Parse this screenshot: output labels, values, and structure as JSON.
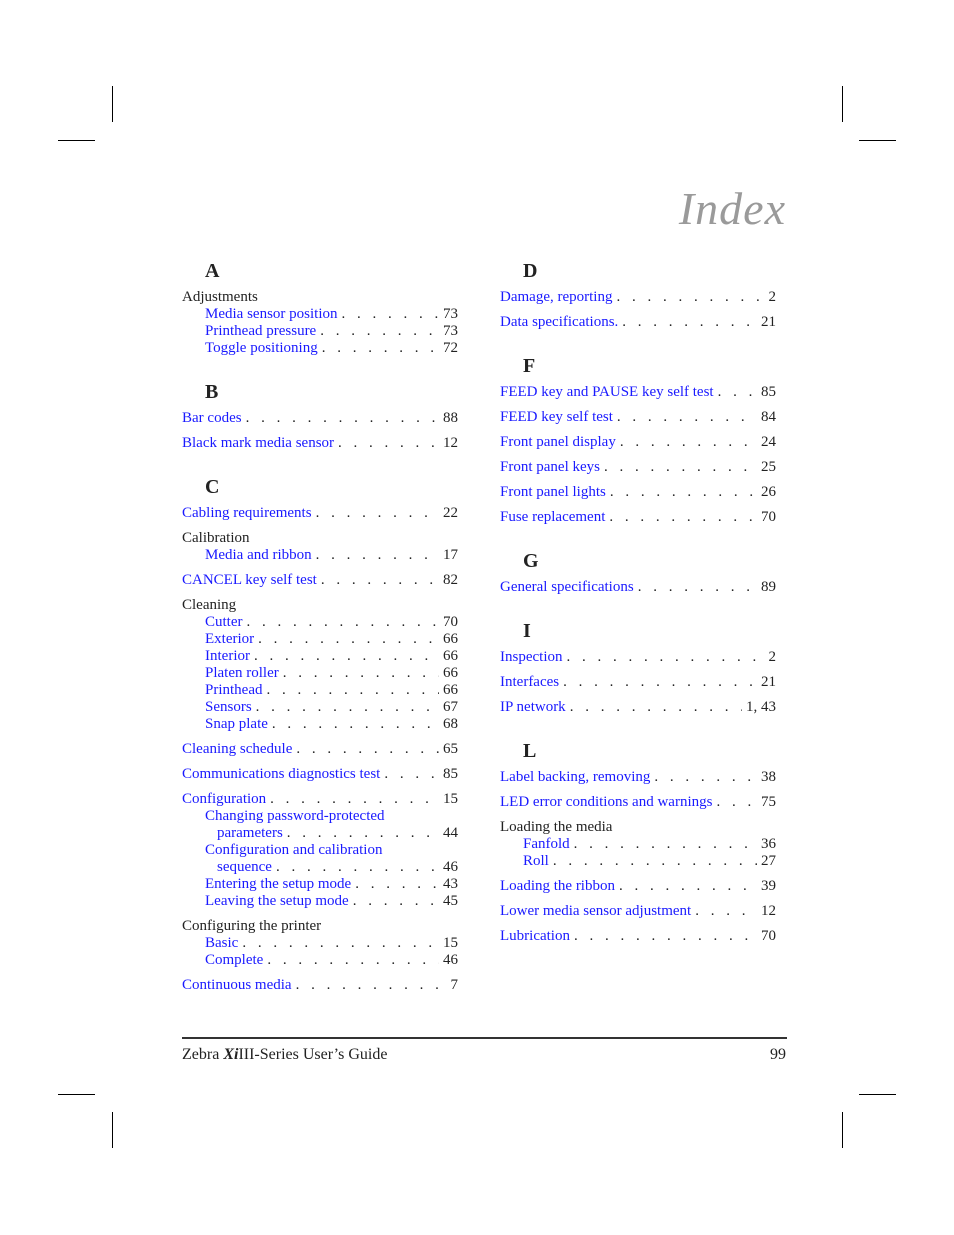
{
  "title": "Index",
  "left_column": [
    {
      "letter": "A",
      "entries": [
        {
          "label": "Adjustments",
          "page": "",
          "level": 0,
          "head": true
        },
        {
          "label": "Media sensor position",
          "page": "73",
          "level": 1
        },
        {
          "label": "Printhead pressure",
          "page": "73",
          "level": 1
        },
        {
          "label": "Toggle positioning",
          "page": "72",
          "level": 1
        }
      ]
    },
    {
      "letter": "B",
      "entries": [
        {
          "label": "Bar codes",
          "page": "88",
          "level": 0
        },
        {
          "label": "Black mark media sensor",
          "page": "12",
          "level": 0
        }
      ]
    },
    {
      "letter": "C",
      "entries": [
        {
          "label": "Cabling requirements",
          "page": "22",
          "level": 0
        },
        {
          "label": "Calibration",
          "page": "",
          "level": 0,
          "head": true
        },
        {
          "label": "Media and ribbon",
          "page": "17",
          "level": 1
        },
        {
          "label": "CANCEL key self test",
          "page": "82",
          "level": 0
        },
        {
          "label": "Cleaning",
          "page": "",
          "level": 0,
          "head": true
        },
        {
          "label": "Cutter",
          "page": "70",
          "level": 1
        },
        {
          "label": "Exterior",
          "page": "66",
          "level": 1
        },
        {
          "label": "Interior",
          "page": "66",
          "level": 1
        },
        {
          "label": "Platen roller",
          "page": "66",
          "level": 1
        },
        {
          "label": "Printhead",
          "page": "66",
          "level": 1
        },
        {
          "label": "Sensors",
          "page": "67",
          "level": 1
        },
        {
          "label": "Snap plate",
          "page": "68",
          "level": 1
        },
        {
          "label": "Cleaning schedule",
          "page": "65",
          "level": 0
        },
        {
          "label": "Communications diagnostics test",
          "page": "85",
          "level": 0
        },
        {
          "label": "Configuration",
          "page": "15",
          "level": 0
        },
        {
          "label": "Changing password-protected",
          "page": "",
          "level": 1,
          "wrap": true
        },
        {
          "label": "parameters",
          "page": "44",
          "level": 2
        },
        {
          "label": "Configuration and calibration",
          "page": "",
          "level": 1,
          "wrap": true
        },
        {
          "label": "sequence",
          "page": "46",
          "level": 2
        },
        {
          "label": "Entering the setup mode",
          "page": "43",
          "level": 1
        },
        {
          "label": "Leaving the setup mode",
          "page": "45",
          "level": 1
        },
        {
          "label": "Configuring the printer",
          "page": "",
          "level": 0,
          "head": true
        },
        {
          "label": "Basic",
          "page": "15",
          "level": 1
        },
        {
          "label": "Complete",
          "page": "46",
          "level": 1
        },
        {
          "label": "Continuous media",
          "page": "7",
          "level": 0
        }
      ]
    }
  ],
  "right_column": [
    {
      "letter": "D",
      "entries": [
        {
          "label": "Damage, reporting",
          "page": "2",
          "level": 0
        },
        {
          "label": "Data specifications.",
          "page": "21",
          "level": 0
        }
      ]
    },
    {
      "letter": "F",
      "entries": [
        {
          "label": "FEED key and PAUSE key self test",
          "page": "85",
          "level": 0
        },
        {
          "label": "FEED key self test",
          "page": "84",
          "level": 0
        },
        {
          "label": "Front panel display",
          "page": "24",
          "level": 0
        },
        {
          "label": "Front panel keys",
          "page": "25",
          "level": 0
        },
        {
          "label": "Front panel lights",
          "page": "26",
          "level": 0
        },
        {
          "label": "Fuse replacement",
          "page": "70",
          "level": 0
        }
      ]
    },
    {
      "letter": "G",
      "entries": [
        {
          "label": "General specifications",
          "page": "89",
          "level": 0
        }
      ]
    },
    {
      "letter": "I",
      "entries": [
        {
          "label": "Inspection",
          "page": "2",
          "level": 0
        },
        {
          "label": "Interfaces",
          "page": "21",
          "level": 0
        },
        {
          "label": "IP network",
          "page": "1, 43",
          "level": 0
        }
      ]
    },
    {
      "letter": "L",
      "entries": [
        {
          "label": "Label backing, removing",
          "page": "38",
          "level": 0
        },
        {
          "label": "LED error conditions and warnings",
          "page": "75",
          "level": 0
        },
        {
          "label": "Loading the media",
          "page": "",
          "level": 0,
          "head": true
        },
        {
          "label": "Fanfold",
          "page": "36",
          "level": 1
        },
        {
          "label": "Roll",
          "page": "27",
          "level": 1
        },
        {
          "label": "Loading the ribbon",
          "page": "39",
          "level": 0
        },
        {
          "label": "Lower media sensor adjustment",
          "page": "12",
          "level": 0
        },
        {
          "label": "Lubrication",
          "page": "70",
          "level": 0
        }
      ]
    }
  ],
  "footer": {
    "brand": "Zebra ",
    "model_emphasis": "Xi",
    "title_rest": "III-Series User’s Guide",
    "page_number": "99"
  }
}
